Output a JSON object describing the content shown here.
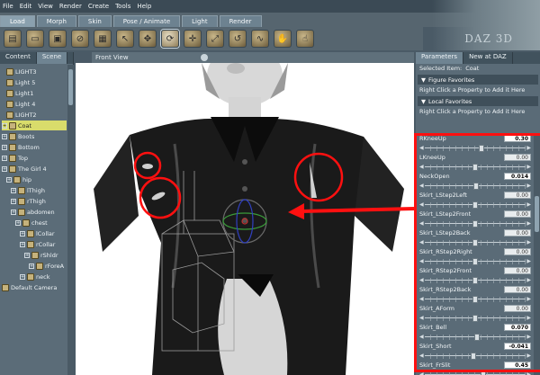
{
  "menu": [
    "File",
    "Edit",
    "View",
    "Render",
    "Create",
    "Tools",
    "Help"
  ],
  "room_tabs": [
    {
      "label": "Load",
      "active": true
    },
    {
      "label": "Morph",
      "active": false
    },
    {
      "label": "Skin",
      "active": false
    },
    {
      "label": "Pose / Animate",
      "active": false
    },
    {
      "label": "Light",
      "active": false
    },
    {
      "label": "Render",
      "active": false
    }
  ],
  "background_text": "DAZ 3D",
  "toolbar_icons": [
    "new-icon",
    "open-icon",
    "save-icon",
    "undo-icon",
    "import-icon",
    "select-icon",
    "translate-icon",
    "rotate-icon",
    "universal-icon",
    "scale-icon",
    "twist-icon",
    "bend-icon",
    "pose-icon",
    "active-pose-icon"
  ],
  "left_panel": {
    "tabs": [
      "Content",
      "Scene"
    ],
    "tree": [
      {
        "label": "LIGHT3",
        "depth": 1,
        "expander": false,
        "selected": false
      },
      {
        "label": "Light 5",
        "depth": 1,
        "expander": false,
        "selected": false
      },
      {
        "label": "Light1",
        "depth": 1,
        "expander": false,
        "selected": false
      },
      {
        "label": "Light 4",
        "depth": 1,
        "expander": false,
        "selected": false
      },
      {
        "label": "LIGHT2",
        "depth": 1,
        "expander": false,
        "selected": false
      },
      {
        "label": "Coat",
        "depth": 0,
        "expander": true,
        "selected": true
      },
      {
        "label": "Boots",
        "depth": 0,
        "expander": true,
        "selected": false
      },
      {
        "label": "Bottom",
        "depth": 0,
        "expander": true,
        "selected": false
      },
      {
        "label": "Top",
        "depth": 0,
        "expander": true,
        "selected": false
      },
      {
        "label": "The Girl 4",
        "depth": 0,
        "expander": true,
        "selected": false
      },
      {
        "label": "hip",
        "depth": 1,
        "expander": true,
        "selected": false
      },
      {
        "label": "lThigh",
        "depth": 2,
        "expander": true,
        "selected": false
      },
      {
        "label": "rThigh",
        "depth": 2,
        "expander": true,
        "selected": false
      },
      {
        "label": "abdomen",
        "depth": 2,
        "expander": true,
        "selected": false
      },
      {
        "label": "chest",
        "depth": 3,
        "expander": true,
        "selected": false
      },
      {
        "label": "lCollar",
        "depth": 4,
        "expander": true,
        "selected": false
      },
      {
        "label": "rCollar",
        "depth": 4,
        "expander": true,
        "selected": false
      },
      {
        "label": "rShldr",
        "depth": 5,
        "expander": true,
        "selected": false
      },
      {
        "label": "rForeA",
        "depth": 6,
        "expander": true,
        "selected": false
      },
      {
        "label": "neck",
        "depth": 4,
        "expander": true,
        "selected": false
      },
      {
        "label": "Default Camera",
        "depth": 0,
        "expander": false,
        "selected": false
      }
    ]
  },
  "viewport": {
    "title": "Front View"
  },
  "right_panel": {
    "tabs": [
      "Parameters",
      "New at DAZ"
    ],
    "selected_item_label": "Selected Item:",
    "selected_item_value": "Coat",
    "figure_favorites": "Figure Favorites",
    "local_favorites": "Local Favorites",
    "hint": "Right Click a Property to Add it Here",
    "dials": [
      {
        "name": "RKneeUp",
        "value": "0.30",
        "modified": true,
        "level": 0.56
      },
      {
        "name": "LKneeUp",
        "value": "0.00",
        "modified": false,
        "level": 0.5
      },
      {
        "name": "NeckOpen",
        "value": "0.014",
        "modified": true,
        "level": 0.51
      },
      {
        "name": "Skirt_LStep2Left",
        "value": "0.00",
        "modified": false,
        "level": 0.5
      },
      {
        "name": "Skirt_LStep2Front",
        "value": "0.00",
        "modified": false,
        "level": 0.5
      },
      {
        "name": "Skirt_LStep2Back",
        "value": "0.00",
        "modified": false,
        "level": 0.5
      },
      {
        "name": "Skirt_RStep2Right",
        "value": "0.00",
        "modified": false,
        "level": 0.5
      },
      {
        "name": "Skirt_RStep2Front",
        "value": "0.00",
        "modified": false,
        "level": 0.5
      },
      {
        "name": "Skirt_RStep2Back",
        "value": "0.00",
        "modified": false,
        "level": 0.5
      },
      {
        "name": "Skirt_AForm",
        "value": "0.00",
        "modified": false,
        "level": 0.5
      },
      {
        "name": "Skirt_Bell",
        "value": "0.070",
        "modified": true,
        "level": 0.52
      },
      {
        "name": "Skirt_Short",
        "value": "-0.041",
        "modified": true,
        "level": 0.48
      },
      {
        "name": "Skirt_FrSlit",
        "value": "0.45",
        "modified": true,
        "level": 0.58
      }
    ]
  },
  "colors": {
    "highlight": "#ff1010",
    "selected_row": "#d9dc6b",
    "panel": "#5a6b77"
  }
}
